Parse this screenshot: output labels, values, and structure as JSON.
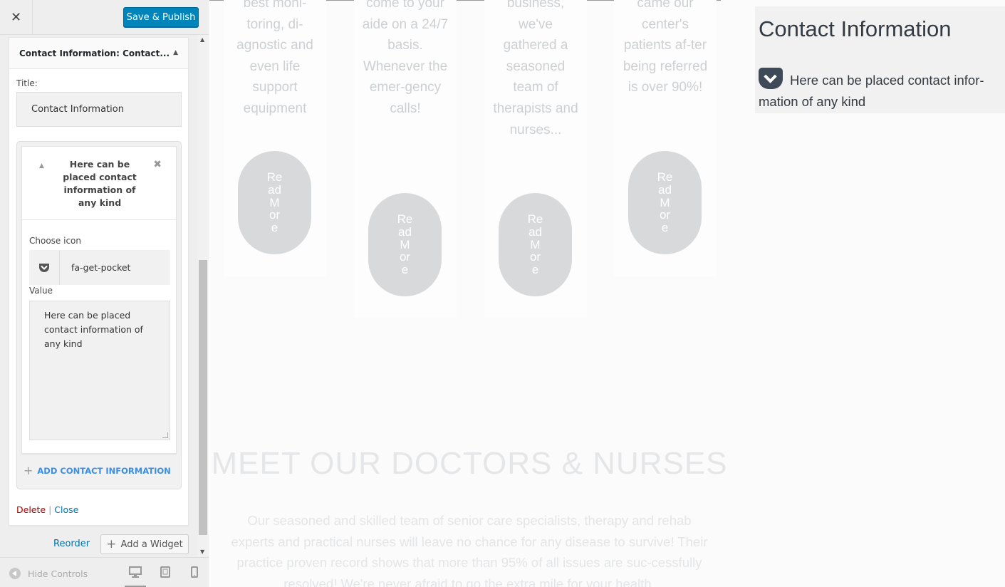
{
  "header": {
    "close_label": "✕",
    "publish_label": "Save & Publish"
  },
  "widget": {
    "title_main": "Contact Information:",
    "title_sub": "Contact...",
    "title_field_label": "Title:",
    "title_value": "Contact Information",
    "item": {
      "heading": "Here can be placed contact information of any kind",
      "choose_icon_label": "Choose icon",
      "icon_name": "fa-get-pocket",
      "value_label": "Value",
      "value_text": "Here can be placed contact information of any kind"
    },
    "add_label": "ADD CONTACT INFORMATION",
    "delete_label": "Delete",
    "separator": "|",
    "close_label": "Close"
  },
  "footer_actions": {
    "reorder_label": "Reorder",
    "add_widget_label": "Add a Widget"
  },
  "footer": {
    "hide_controls_label": "Hide Controls"
  },
  "preview": {
    "cards": [
      {
        "text": "best moni-toring, di-agnostic and even life support equipment",
        "button": "Read More"
      },
      {
        "text": "come to your aide on a 24/7 basis. Whenever the emer-gency calls!",
        "button": "Read More"
      },
      {
        "text": "business, we've gathered a seasoned team of therapists and nurses...",
        "button": "Read More"
      },
      {
        "text": "came our center's patients af-ter being referred is over 90%!",
        "button": "Read More"
      }
    ],
    "section_title": "MEET OUR DOCTORS & NURSES",
    "section_text": "Our seasoned and skilled team of senior care specialists, therapy and rehab experts and practical nurses will leave no chance for any disease to survive! Their practice proven record shows that more than 95% of all issues are suc-cessfully resolved! We're never afraid to go the extra mile for your health.",
    "contact_widget": {
      "title": "Contact Information",
      "icon": "get-pocket-icon",
      "text": "Here can be placed contact infor-mation of any kind"
    }
  }
}
